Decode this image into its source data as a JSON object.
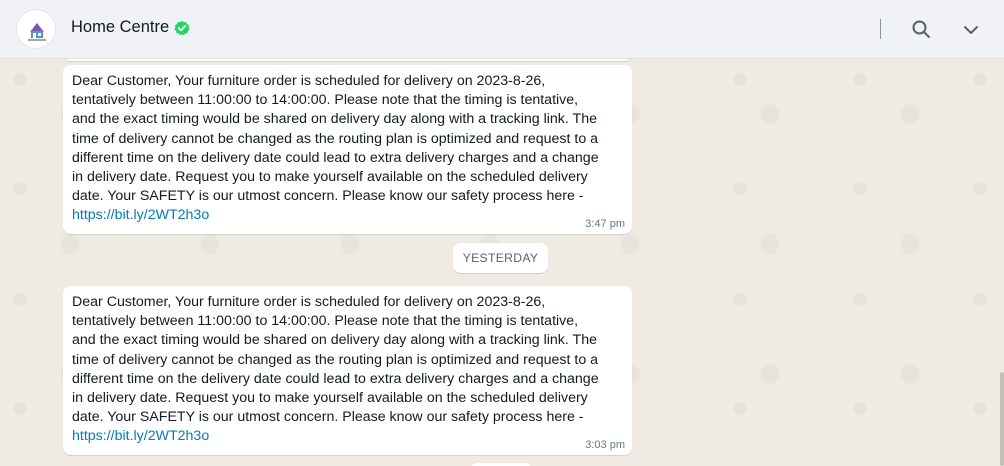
{
  "header": {
    "contact_name": "Home Centre",
    "verified_icon": "verified-check-icon",
    "search_icon": "search-icon",
    "menu_icon": "chevron-down-icon",
    "verified_color": "#25d366"
  },
  "chat": {
    "messages": [
      {
        "text": "Dear Customer, Your furniture order is scheduled for delivery on 2023-8-26,\ntentatively between 11:00:00 to 14:00:00. Please note that the timing is tentative,\nand the exact timing would be shared on delivery day along with a tracking link. The\ntime of delivery cannot be changed as the routing plan is optimized and request to a\ndifferent time on the delivery date could lead to extra delivery charges and a change\nin delivery date. Request you to make yourself available on the scheduled delivery\ndate. Your SAFETY is our utmost concern. Please know our safety process here -",
        "link": "https://bit.ly/2WT2h3o",
        "time": "3:47 pm"
      },
      {
        "text": "Dear Customer, Your furniture order is scheduled for delivery on 2023-8-26,\ntentatively between 11:00:00 to 14:00:00. Please note that the timing is tentative,\nand the exact timing would be shared on delivery day along with a tracking link. The\ntime of delivery cannot be changed as the routing plan is optimized and request to a\ndifferent time on the delivery date could lead to extra delivery charges and a change\nin delivery date. Request you to make yourself available on the scheduled delivery\ndate. Your SAFETY is our utmost concern. Please know our safety process here -",
        "link": "https://bit.ly/2WT2h3o",
        "time": "3:03 pm"
      }
    ],
    "date_divider": "YESTERDAY"
  }
}
